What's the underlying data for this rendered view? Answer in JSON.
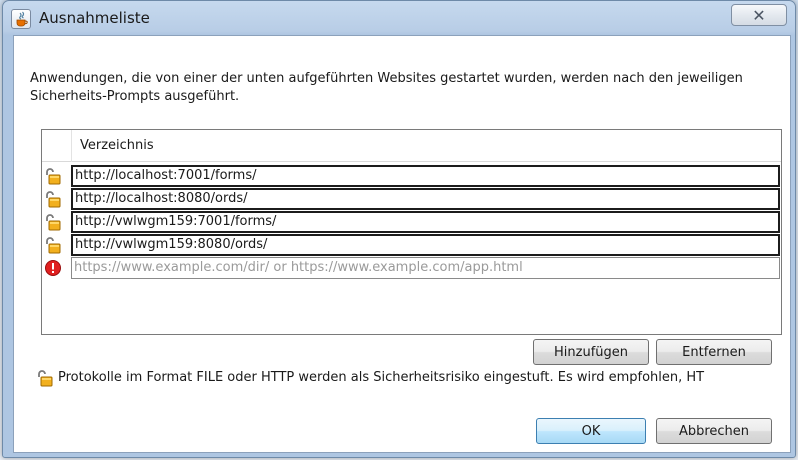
{
  "window": {
    "title": "Ausnahmeliste",
    "close_symbol": "✕"
  },
  "description": "Anwendungen, die von einer der unten aufgeführten Websites gestartet wurden, werden nach den jeweiligen Sicherheits-Prompts ausgeführt.",
  "table": {
    "column_header": "Verzeichnis",
    "rows": [
      {
        "icon": "unlocked-padlock-icon",
        "url": "http://localhost:7001/forms/"
      },
      {
        "icon": "unlocked-padlock-icon",
        "url": "http://localhost:8080/ords/"
      },
      {
        "icon": "unlocked-padlock-icon",
        "url": "http://vwlwgm159:7001/forms/"
      },
      {
        "icon": "unlocked-padlock-icon",
        "url": "http://vwlwgm159:8080/ords/"
      }
    ],
    "new_entry": {
      "icon": "error-icon",
      "placeholder": "https://www.example.com/dir/ or https://www.example.com/app.html"
    }
  },
  "buttons": {
    "add": "Hinzufügen",
    "remove": "Entfernen",
    "ok": "OK",
    "cancel": "Abbrechen"
  },
  "warning": {
    "icon": "unlocked-padlock-icon",
    "text": "Protokolle im Format FILE oder HTTP werden als Sicherheitsrisiko eingestuft. Es wird empfohlen, HT"
  },
  "colors": {
    "title_bar": "#b8cde6",
    "ok_button": "#bee6fd",
    "error_icon": "#e02020",
    "padlock": "#e8a317"
  }
}
